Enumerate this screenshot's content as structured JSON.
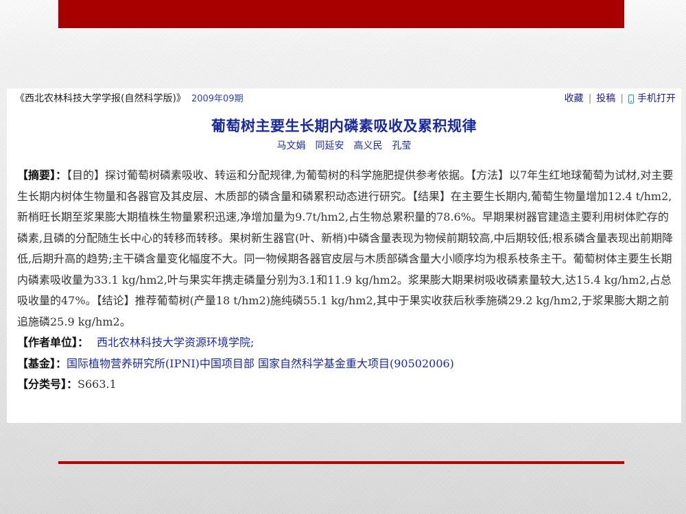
{
  "header": {
    "journal": "《西北农林科技大学学报(自然科学版)》",
    "issue": "2009年09期",
    "actions": {
      "favorite": "收藏",
      "submit": "投稿",
      "mobile": "手机打开",
      "separator": "|"
    }
  },
  "article": {
    "title": "葡萄树主要生长期内磷素吸收及累积规律",
    "authors": [
      "马文娟",
      "同延安",
      "高义民",
      "孔莹"
    ],
    "abstract_label": "【摘要】：",
    "abstract": "【目的】探讨葡萄树磷素吸收、转运和分配规律,为葡萄树的科学施肥提供参考依据。【方法】以7年生红地球葡萄为试材,对主要生长期内树体生物量和各器官及其皮层、木质部的磷含量和磷累积动态进行研究。【结果】在主要生长期内,葡萄生物量增加12.4 t/hm2,新梢旺长期至浆果膨大期植株生物量累积迅速,净增加量为9.7t/hm2,占生物总累积量的78.6%。早期果树器官建造主要利用树体贮存的磷素,且磷的分配随生长中心的转移而转移。果树新生器官(叶、新梢)中磷含量表现为物候前期较高,中后期较低;根系磷含量表现出前期降低,后期升高的趋势;主干磷含量变化幅度不大。同一物候期各器官皮层与木质部磷含量大小顺序均为根系枝条主干。葡萄树体主要生长期内磷素吸收量为33.1 kg/hm2,叶与果实年携走磷量分别为3.1和11.9 kg/hm2。浆果膨大期果树吸收磷素量较大,达15.4 kg/hm2,占总吸收量的47%。【结论】推荐葡萄树(产量18 t/hm2)施纯磷55.1 kg/hm2,其中于果实收获后秋季施磷29.2 kg/hm2,于浆果膨大期之前追施磷25.9 kg/hm2。",
    "affiliation_label": "【作者单位】：",
    "affiliation": "西北农林科技大学资源环境学院;",
    "fund_label": "【基金】：",
    "fund": "国际植物营养研究所(IPNI)中国项目部 国家自然科学基金重大项目(90502006)",
    "classification_label": "【分类号】：",
    "classification": "S663.1"
  },
  "colors": {
    "banner": "#a80000",
    "link": "#1a2a9c"
  }
}
